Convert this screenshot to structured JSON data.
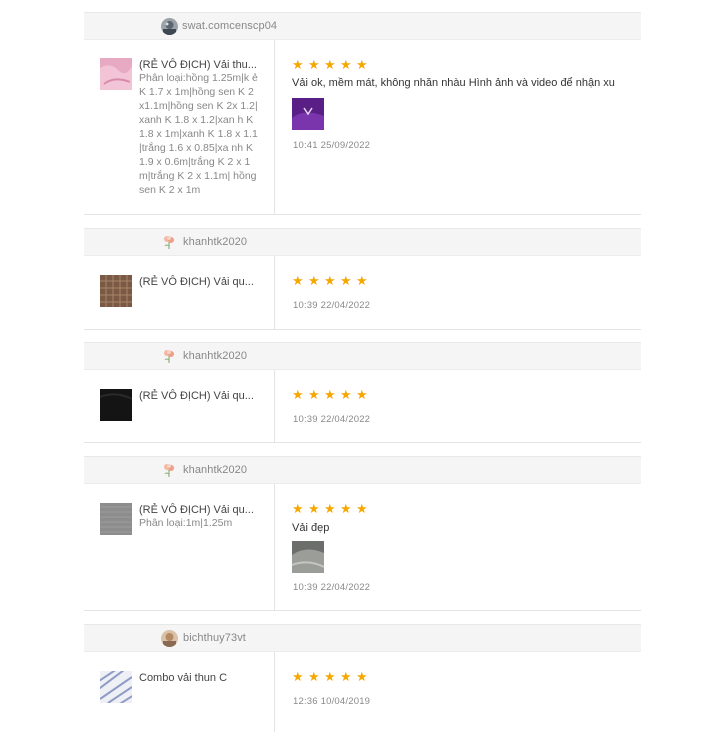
{
  "colors": {
    "star": "#f6a700",
    "header_bg": "#f5f5f5",
    "divider": "#e4e4e4"
  },
  "reviews": [
    {
      "username": "swat.comcenscp04",
      "avatar_icon": "user-avatar-icon",
      "product_name": "(RẺ VÔ ĐỊCH) Vải thu...",
      "variant": "Phân loại:hồng 1.25m|k ẻ K 1.7 x 1m|hồng sen K 2x1.1m|hồng sen K 2x 1.2|xanh K 1.8 x 1.2|xan h K 1.8 x 1m|xanh K 1.8 x 1.1|trắng 1.6 x 0.85|xa nh K 1.9 x 0.6m|trắng K 2 x 1m|trắng K 2 x 1.1m| hồng sen K 2 x 1m",
      "rating": 5,
      "comment": "Vải ok, mềm mát, không nhăn nhàu Hình ảnh và video để nhận xu",
      "has_photo": true,
      "time": "10:41 25/09/2022"
    },
    {
      "username": "khanhtk2020",
      "avatar_icon": "flower-avatar-icon",
      "product_name": "(RẺ VÔ ĐỊCH) Vải qu...",
      "variant": "",
      "rating": 5,
      "comment": "",
      "has_photo": false,
      "time": "10:39 22/04/2022"
    },
    {
      "username": "khanhtk2020",
      "avatar_icon": "flower-avatar-icon",
      "product_name": "(RẺ VÔ ĐỊCH) Vải qu...",
      "variant": "",
      "rating": 5,
      "comment": "",
      "has_photo": false,
      "time": "10:39 22/04/2022"
    },
    {
      "username": "khanhtk2020",
      "avatar_icon": "flower-avatar-icon",
      "product_name": "(RẺ VÔ ĐỊCH) Vải qu...",
      "variant": "Phân loại:1m|1.25m",
      "rating": 5,
      "comment": "Vải đẹp",
      "has_photo": true,
      "time": "10:39 22/04/2022"
    },
    {
      "username": "bichthuy73vt",
      "avatar_icon": "user-avatar-icon",
      "product_name": "Combo vải thun C",
      "variant": "",
      "rating": 5,
      "comment": "",
      "has_photo": false,
      "time": "12:36 10/04/2019"
    }
  ]
}
